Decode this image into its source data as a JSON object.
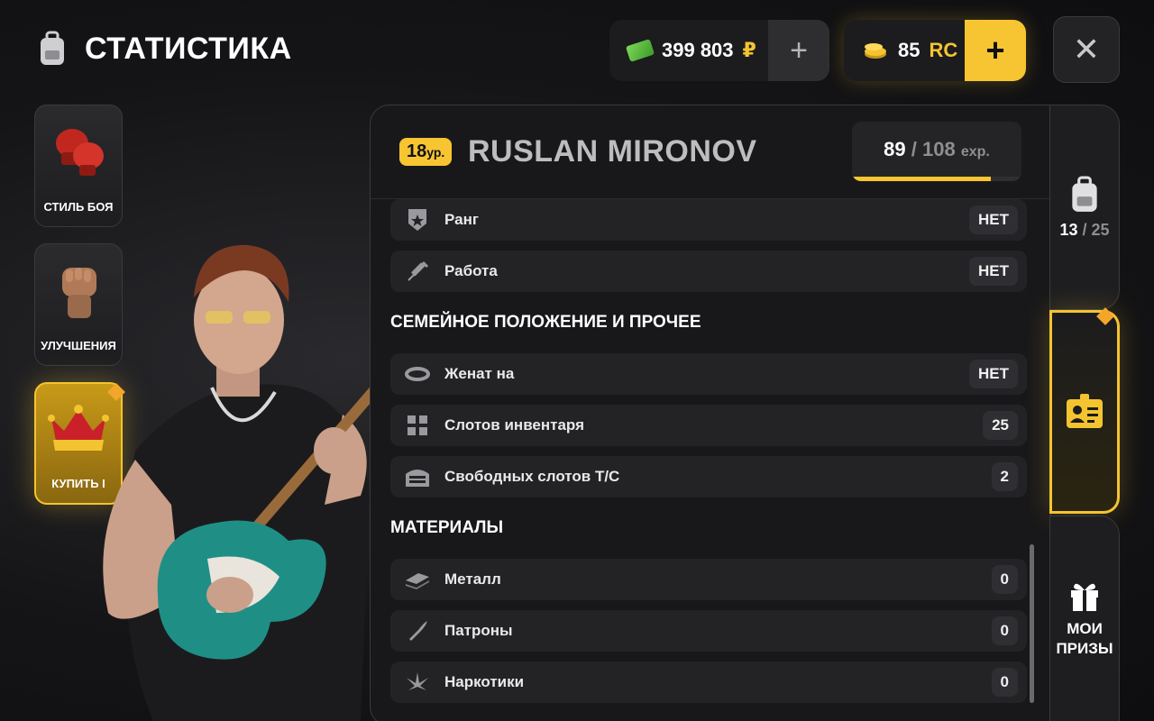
{
  "header": {
    "title": "СТАТИСТИКА",
    "icon": "backpack-icon",
    "money": {
      "amount": "399 803",
      "currency": "₽"
    },
    "rc": {
      "amount": "85",
      "currency": "RC"
    },
    "plus": "+",
    "close": "✕"
  },
  "left_nav": [
    {
      "label": "СТИЛЬ БОЯ",
      "icon": "boxing-gloves-icon"
    },
    {
      "label": "УЛУЧШЕНИЯ",
      "icon": "fist-icon"
    },
    {
      "label": "КУПИТЬ I",
      "icon": "crown-icon"
    }
  ],
  "player": {
    "level": "18",
    "level_suffix": "ур.",
    "name": "RUSLAN MIRONOV",
    "exp_current": "89",
    "exp_max": "108",
    "exp_unit": "exp.",
    "exp_progress": 0.82
  },
  "rows_top": [
    {
      "label": "Ранг",
      "value": "НЕТ",
      "icon": "rank-star-icon"
    },
    {
      "label": "Работа",
      "value": "НЕТ",
      "icon": "syringe-icon"
    }
  ],
  "section_family": "СЕМЕЙНОЕ ПОЛОЖЕНИЕ И ПРОЧЕЕ",
  "rows_family": [
    {
      "label": "Женат на",
      "value": "НЕТ",
      "icon": "ring-icon"
    },
    {
      "label": "Слотов инвентаря",
      "value": "25",
      "icon": "grid-icon"
    },
    {
      "label": "Свободных слотов Т/С",
      "value": "2",
      "icon": "garage-icon"
    }
  ],
  "section_materials": "МАТЕРИАЛЫ",
  "rows_materials": [
    {
      "label": "Металл",
      "value": "0",
      "icon": "metal-icon"
    },
    {
      "label": "Патроны",
      "value": "0",
      "icon": "bullet-icon"
    },
    {
      "label": "Наркотики",
      "value": "0",
      "icon": "leaf-icon"
    }
  ],
  "right_nav": {
    "inventory": {
      "current": "13",
      "max": "25",
      "icon": "backpack-icon"
    },
    "stats": {
      "icon": "id-card-icon"
    },
    "prizes": {
      "label_line1": "МОИ",
      "label_line2": "ПРИЗЫ",
      "icon": "gift-icon"
    }
  },
  "colors": {
    "accent": "#f6c531",
    "panel": "#18181a",
    "row": "#232326"
  }
}
